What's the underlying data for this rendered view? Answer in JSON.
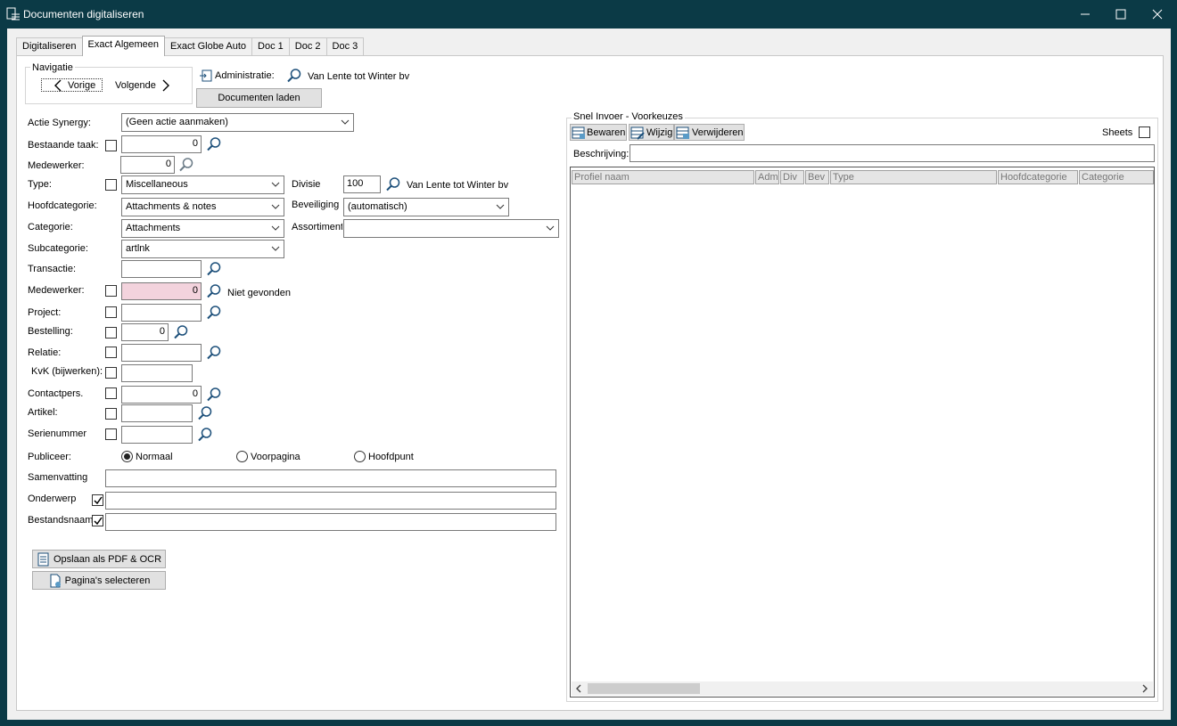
{
  "window": {
    "title": "Documenten digitaliseren",
    "minimize": "—",
    "maximize": "☐",
    "close": "✕"
  },
  "tabs": [
    "Digitaliseren",
    "Exact Algemeen",
    "Exact Globe Auto",
    "Doc 1",
    "Doc 2",
    "Doc 3"
  ],
  "navigation": {
    "title": "Navigatie",
    "prev": "Vorige",
    "next": "Volgende"
  },
  "administration": {
    "label": "Administratie:",
    "value": "Van Lente tot Winter bv",
    "load_button": "Documenten laden"
  },
  "form": {
    "actie_synergy": {
      "label": "Actie Synergy:",
      "value": "(Geen actie aanmaken)"
    },
    "bestaande_taak": {
      "label": "Bestaande taak:",
      "value": "0"
    },
    "medewerker1": {
      "label": "Medewerker:",
      "value": "0"
    },
    "type": {
      "label": "Type:",
      "value": "Miscellaneous"
    },
    "divisie": {
      "label": "Divisie",
      "value": "100",
      "name": "Van Lente tot Winter bv"
    },
    "hoofdcategorie": {
      "label": "Hoofdcategorie:",
      "value": "Attachments & notes"
    },
    "beveiliging": {
      "label": "Beveiliging",
      "value": "(automatisch)"
    },
    "categorie": {
      "label": "Categorie:",
      "value": "Attachments"
    },
    "assortiment": {
      "label": "Assortiment",
      "value": ""
    },
    "subcategorie": {
      "label": "Subcategorie:",
      "value": "artlnk"
    },
    "transactie": {
      "label": "Transactie:",
      "value": ""
    },
    "medewerker2": {
      "label": "Medewerker:",
      "value": "0",
      "status": "Niet gevonden"
    },
    "project": {
      "label": "Project:",
      "value": ""
    },
    "bestelling": {
      "label": "Bestelling:",
      "value": "0"
    },
    "relatie": {
      "label": "Relatie:",
      "value": ""
    },
    "kvk": {
      "label": "KvK (bijwerken):",
      "value": ""
    },
    "contactpers": {
      "label": "Contactpers.",
      "value": "0"
    },
    "artikel": {
      "label": "Artikel:",
      "value": ""
    },
    "serienummer": {
      "label": "Serienummer",
      "value": ""
    },
    "publiceer": {
      "label": "Publiceer:",
      "options": [
        "Normaal",
        "Voorpagina",
        "Hoofdpunt"
      ],
      "selected": "Normaal"
    },
    "samenvatting": {
      "label": "Samenvatting",
      "value": ""
    },
    "onderwerp": {
      "label": "Onderwerp",
      "value": "",
      "checked": true
    },
    "bestandsnaam": {
      "label": "Bestandsnaam",
      "value": "",
      "checked": true
    }
  },
  "buttons": {
    "save_pdf": "Opslaan als PDF & OCR",
    "select_pages": "Pagina's selecteren"
  },
  "quick_entry": {
    "title": "Snel Invoer - Voorkeuzes",
    "save": "Bewaren",
    "edit": "Wijzig",
    "delete": "Verwijderen",
    "sheets_label": "Sheets",
    "description_label": "Beschrijving:",
    "columns": [
      "Profiel naam",
      "Adm",
      "Div",
      "Bev",
      "Type",
      "Hoofdcategorie",
      "Categorie"
    ]
  }
}
